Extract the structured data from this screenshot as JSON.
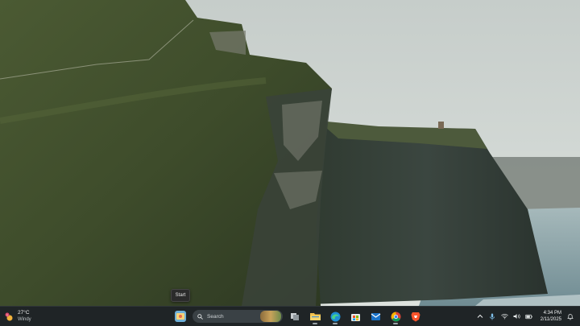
{
  "tooltip": {
    "text": "Start"
  },
  "weather": {
    "temperature": "27°C",
    "condition": "Windy",
    "badge": "1",
    "icon": "weather-sun-icon"
  },
  "taskbar": {
    "start_icon": "windows-start-icon",
    "search_label": "Search",
    "apps": [
      {
        "name": "task-view-icon"
      },
      {
        "name": "file-explorer-icon"
      },
      {
        "name": "edge-browser-icon"
      },
      {
        "name": "microsoft-store-icon"
      },
      {
        "name": "outlook-mail-icon"
      },
      {
        "name": "chrome-icon"
      },
      {
        "name": "brave-browser-icon"
      }
    ]
  },
  "tray": {
    "time": "4:34 PM",
    "date": "2/11/2025",
    "icons": [
      "chevron-up-icon",
      "microphone-icon",
      "wifi-icon",
      "speaker-icon",
      "battery-icon",
      "notification-bell-icon"
    ]
  },
  "colors": {
    "taskbar_bg": "#1f2426",
    "sky": "#cfd6d4",
    "cliff_green": "#3d4a2b",
    "sea": "#8fa9ae"
  }
}
